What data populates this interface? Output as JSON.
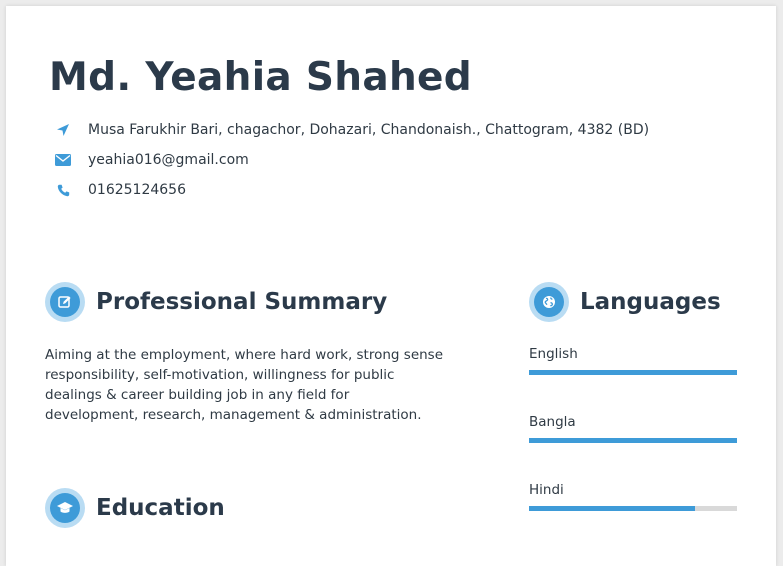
{
  "header": {
    "name": "Md. Yeahia Shahed",
    "contacts": [
      {
        "icon": "location-arrow-icon",
        "text": "Musa Farukhir Bari, chagachor, Dohazari, Chandonaish., Chattogram, 4382 (BD)"
      },
      {
        "icon": "envelope-icon",
        "text": "yeahia016@gmail.com"
      },
      {
        "icon": "phone-icon",
        "text": "01625124656"
      }
    ]
  },
  "summary": {
    "title": "Professional Summary",
    "icon": "edit-icon",
    "text": "Aiming at the employment, where hard work, strong sense responsibility, self-motivation, willingness for public dealings & career building job in any field for development, research, management & administration."
  },
  "education": {
    "title": "Education",
    "icon": "graduation-cap-icon"
  },
  "languages": {
    "title": "Languages",
    "icon": "globe-icon",
    "items": [
      {
        "label": "English",
        "level": 1.0
      },
      {
        "label": "Bangla",
        "level": 1.0
      },
      {
        "label": "Hindi",
        "level": 0.8
      }
    ]
  },
  "colors": {
    "accent": "#3e9bd8",
    "accent_light": "#b9dcf3",
    "heading": "#2b3a4a",
    "track": "#d9d9d9"
  }
}
